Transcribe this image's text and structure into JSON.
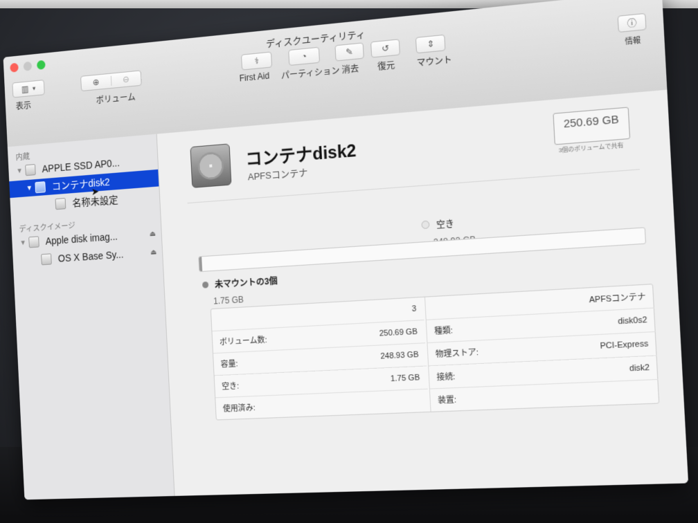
{
  "window": {
    "title": "ディスクユーティリティ"
  },
  "toolbar": {
    "view_label": "表示",
    "volume_label": "ボリューム",
    "first_aid_label": "First Aid",
    "partition_label": "パーティション",
    "erase_label": "消去",
    "restore_label": "復元",
    "mount_label": "マウント",
    "info_label": "情報"
  },
  "sidebar": {
    "internal_section": "内蔵",
    "disk_images_section": "ディスクイメージ",
    "items": [
      {
        "label": "APPLE SSD AP0..."
      },
      {
        "label": "コンテナdisk2"
      },
      {
        "label": "名称未設定"
      },
      {
        "label": "Apple disk imag..."
      },
      {
        "label": "OS X Base Sy..."
      }
    ]
  },
  "main": {
    "title": "コンテナdisk2",
    "subtitle": "APFSコンテナ",
    "capacity": "250.69 GB",
    "capacity_caption": "3個のボリュームで共有",
    "usage": {
      "used_fraction": 0.007,
      "free_label": "空き",
      "free_value": "248.93 GB",
      "unmounted_label": "未マウントの3個",
      "unmounted_value": "1.75 GB"
    },
    "info_left": [
      {
        "label": "",
        "value": "3"
      },
      {
        "label": "ボリューム数:",
        "value": "250.69 GB"
      },
      {
        "label": "容量:",
        "value": "248.93 GB"
      },
      {
        "label": "空き:",
        "value": "1.75 GB"
      },
      {
        "label": "使用済み:",
        "value": ""
      }
    ],
    "info_right": [
      {
        "label": "",
        "value": "APFSコンテナ"
      },
      {
        "label": "種類:",
        "value": "disk0s2"
      },
      {
        "label": "物理ストア:",
        "value": "PCI-Express"
      },
      {
        "label": "接続:",
        "value": "disk2"
      },
      {
        "label": "装置:",
        "value": ""
      }
    ]
  },
  "colors": {
    "selection": "#0f46d6",
    "close": "#fc5f57",
    "zoom": "#34c84a"
  }
}
